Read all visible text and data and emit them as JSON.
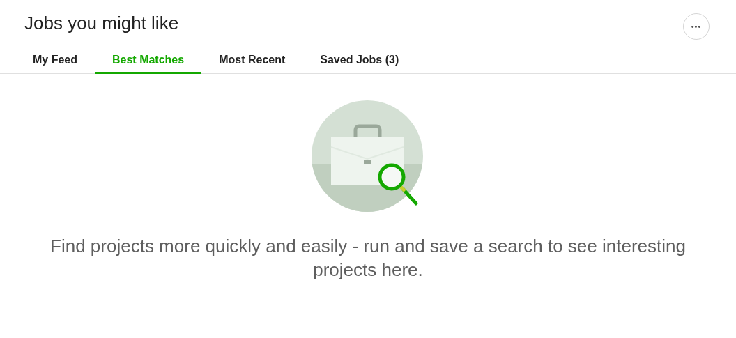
{
  "header": {
    "title": "Jobs you might like",
    "menu_button": "•••"
  },
  "tabs": [
    {
      "label": "My Feed",
      "selected": false
    },
    {
      "label": "Best Matches",
      "selected": true
    },
    {
      "label": "Most Recent",
      "selected": false
    },
    {
      "label": "Saved Jobs (3)",
      "selected": false
    }
  ],
  "empty_state": {
    "message": "Find projects more quickly and easily - run and save a search to see interesting projects here."
  }
}
